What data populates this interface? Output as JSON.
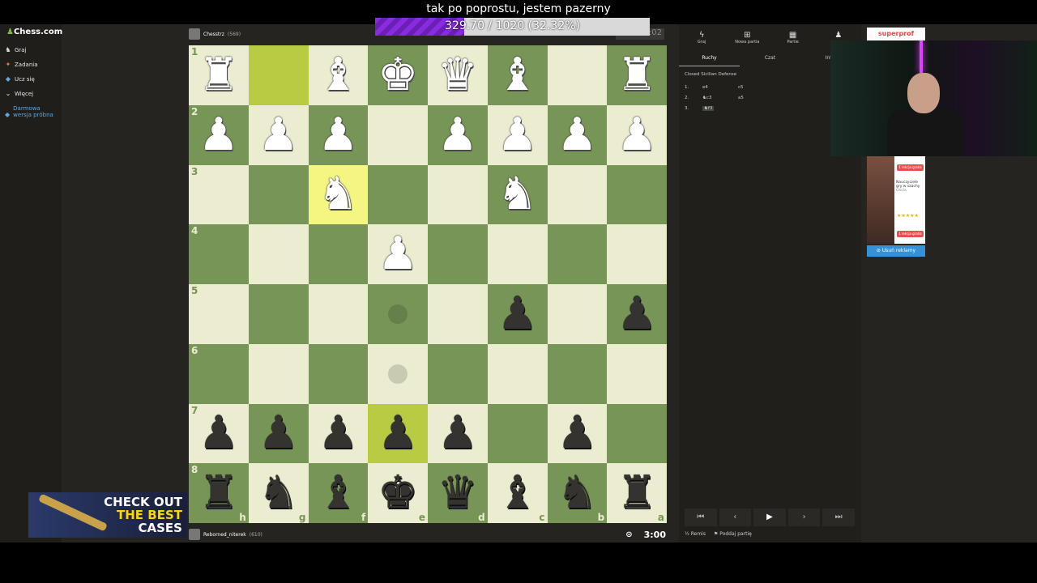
{
  "overlay": {
    "title": "tak po poprostu, jestem pazerny",
    "goal_text": "329.70 / 1020 (32.32%)",
    "goal_fraction": 0.3232,
    "goal_color": "#8a2be2"
  },
  "sidebar": {
    "logo": "Chess.com",
    "items": [
      {
        "label": "Graj",
        "icon": "play-icon"
      },
      {
        "label": "Zadania",
        "icon": "puzzle-icon"
      },
      {
        "label": "Ucz się",
        "icon": "learn-icon"
      },
      {
        "label": "Więcej",
        "icon": "chevron-down-icon"
      },
      {
        "label": "Darmowa wersja próbna",
        "icon": "diamond-icon"
      }
    ]
  },
  "players": {
    "top": {
      "name": "Chesstrz",
      "rating": "(569)"
    },
    "bottom": {
      "name": "Reborned_niterek",
      "rating": "(610)",
      "clock": "3:00"
    },
    "top_clock": "3:02"
  },
  "board": {
    "colors": {
      "light": "#ebecd0",
      "dark": "#779556",
      "hl_light": "#f5f682",
      "hl_dark": "#b9ca43"
    },
    "ranks": [
      "1",
      "2",
      "3",
      "4",
      "5",
      "6",
      "7",
      "8"
    ],
    "files_bottom": [
      "h",
      "g",
      "f",
      "e",
      "d",
      "c",
      "b",
      "a"
    ],
    "rows": [
      [
        "wR",
        "",
        "wB",
        "wK",
        "wQ",
        "wB",
        "",
        "wR"
      ],
      [
        "wP",
        "wP",
        "wP",
        "",
        "wP",
        "wP",
        "wP",
        "wP"
      ],
      [
        "",
        "",
        "wN",
        "",
        "",
        "wN",
        "",
        ""
      ],
      [
        "",
        "",
        "",
        "wP",
        "",
        "",
        "",
        ""
      ],
      [
        "",
        "",
        "",
        "",
        "",
        "bP",
        "",
        "bP"
      ],
      [
        "",
        "",
        "",
        "",
        "",
        "",
        "",
        ""
      ],
      [
        "bP",
        "bP",
        "bP",
        "bP",
        "bP",
        "",
        "bP",
        ""
      ],
      [
        "bR",
        "bN",
        "bB",
        "bK",
        "bQ",
        "bB",
        "bN",
        "bR"
      ]
    ],
    "highlights": [
      [
        0,
        1
      ],
      [
        2,
        2
      ],
      [
        6,
        3
      ]
    ],
    "hints": [
      [
        4,
        3
      ],
      [
        5,
        3
      ]
    ]
  },
  "panel": {
    "tabs": [
      {
        "label": "Graj",
        "icon": "lightning-icon"
      },
      {
        "label": "Nowa partia",
        "icon": "plus-icon"
      },
      {
        "label": "Partie",
        "icon": "games-icon"
      },
      {
        "label": "",
        "icon": "friends-icon"
      }
    ],
    "subtabs": [
      "Ruchy",
      "Czat",
      "Infor"
    ],
    "opening": "Closed Sicilian Defense",
    "moves": [
      {
        "n": "1.",
        "w": "e4",
        "b": "c5"
      },
      {
        "n": "2.",
        "w": "♞c3",
        "b": "a5"
      },
      {
        "n": "3.",
        "w": "♞f3",
        "b": ""
      }
    ],
    "nav": [
      "⏮",
      "‹",
      "▶",
      "›",
      "⏭"
    ],
    "actions": [
      "Remis",
      "Poddaj partię"
    ]
  },
  "ads": {
    "top": "superprof",
    "text": "Nauczyciele gry w szachy",
    "sub": "Olivia",
    "btn": "1 lekcja gratis",
    "stars": "★★★★★",
    "remove": "Usuń reklamy"
  },
  "promo": {
    "line1": "CHECK OUT",
    "line2": "THE BEST",
    "line3": "CASES"
  }
}
